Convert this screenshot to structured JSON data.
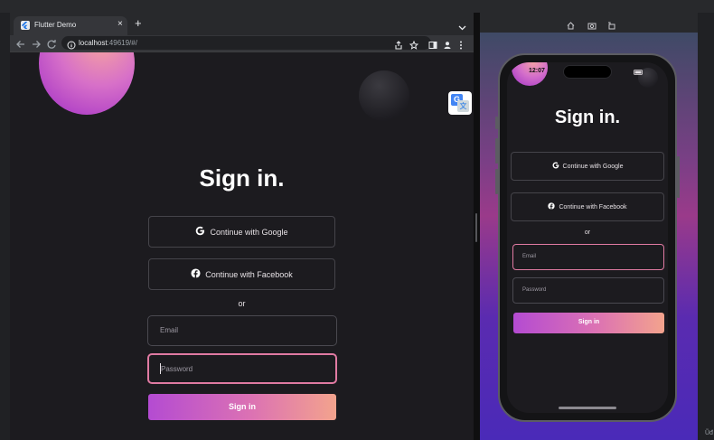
{
  "browser": {
    "tab_title": "Flutter Demo",
    "tab_close": "×",
    "new_tab": "+",
    "url_host": "localhost",
    "url_rest": ":49619/#/"
  },
  "page": {
    "title": "Sign in.",
    "google_label": "Continue with Google",
    "facebook_label": "Continue with Facebook",
    "or_label": "or",
    "email_placeholder": "Email",
    "password_placeholder": "Password",
    "signin_label": "Sign in"
  },
  "emulator": {
    "time": "12:07",
    "title": "Sign in.",
    "google_label": "Continue with Google",
    "facebook_label": "Continue with Facebook",
    "or_label": "or",
    "email_placeholder": "Email",
    "password_placeholder": "Password",
    "signin_label": "Sign in"
  },
  "edge_text": "Ũđ",
  "colors": {
    "background": "#1c1b1f",
    "accent_start": "#b44bd2",
    "accent_end": "#f3a38d",
    "focus_border": "#e07aa2"
  },
  "icons": [
    "google-icon",
    "facebook-icon",
    "translate-icon",
    "back-icon",
    "forward-icon",
    "reload-icon",
    "info-icon",
    "share-icon",
    "star-icon",
    "sidebar-icon",
    "profile-icon",
    "menu-icon",
    "home-icon",
    "screenshot-icon",
    "rotate-icon"
  ]
}
